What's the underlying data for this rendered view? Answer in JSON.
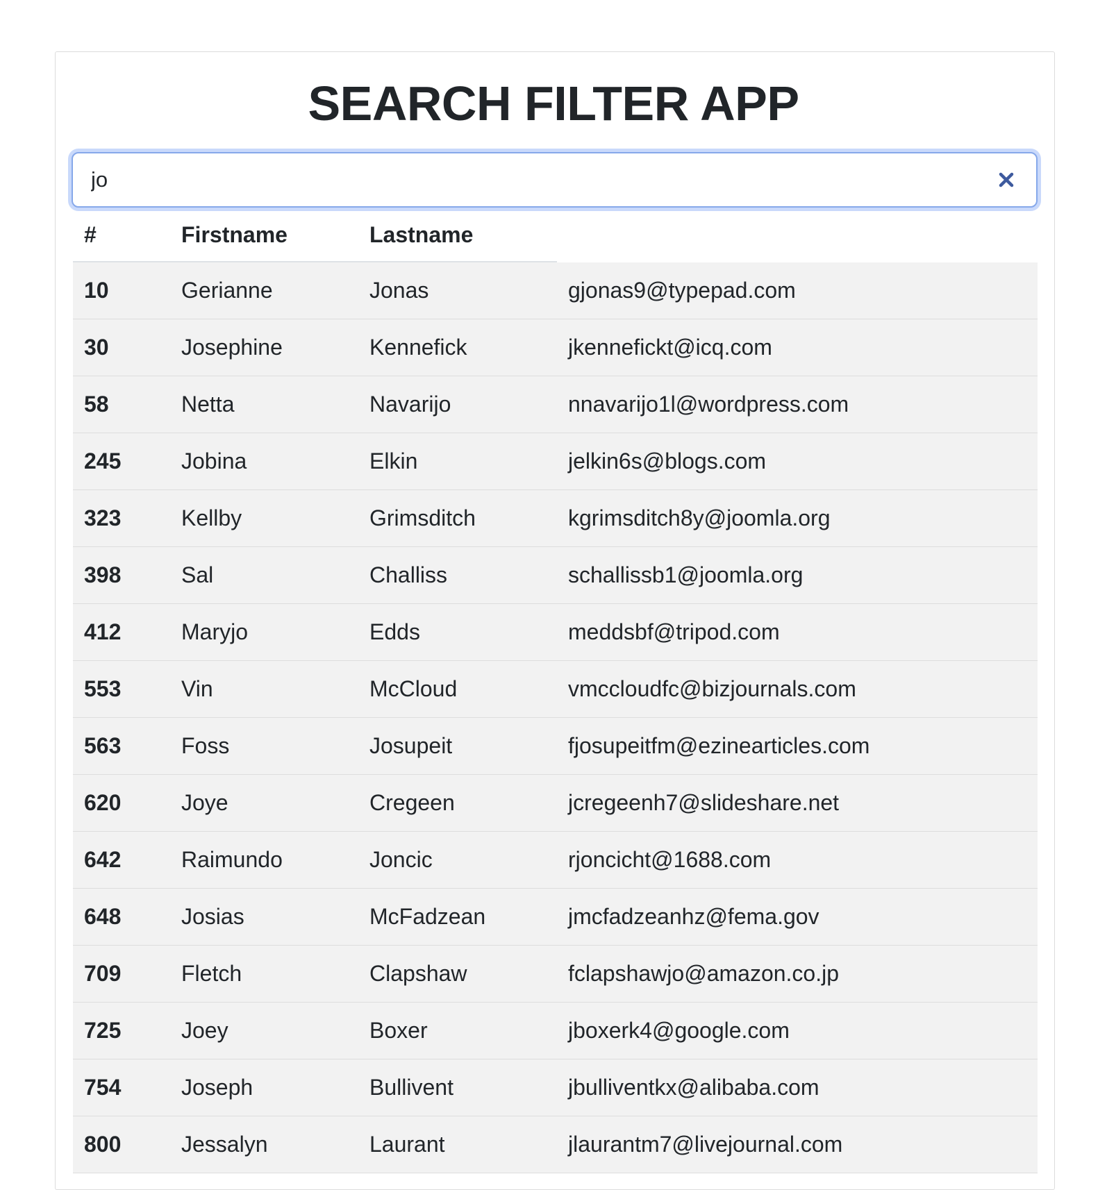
{
  "app": {
    "title": "SEARCH FILTER APP"
  },
  "search": {
    "value": "jo",
    "placeholder": "",
    "clear_icon": "close-icon"
  },
  "table": {
    "headers": [
      "#",
      "Firstname",
      "Lastname"
    ],
    "rows": [
      {
        "id": "10",
        "firstname": "Gerianne",
        "lastname": "Jonas",
        "email": "gjonas9@typepad.com"
      },
      {
        "id": "30",
        "firstname": "Josephine",
        "lastname": "Kennefick",
        "email": "jkennefickt@icq.com"
      },
      {
        "id": "58",
        "firstname": "Netta",
        "lastname": "Navarijo",
        "email": "nnavarijo1l@wordpress.com"
      },
      {
        "id": "245",
        "firstname": "Jobina",
        "lastname": "Elkin",
        "email": "jelkin6s@blogs.com"
      },
      {
        "id": "323",
        "firstname": "Kellby",
        "lastname": "Grimsditch",
        "email": "kgrimsditch8y@joomla.org"
      },
      {
        "id": "398",
        "firstname": "Sal",
        "lastname": "Challiss",
        "email": "schallissb1@joomla.org"
      },
      {
        "id": "412",
        "firstname": "Maryjo",
        "lastname": "Edds",
        "email": "meddsbf@tripod.com"
      },
      {
        "id": "553",
        "firstname": "Vin",
        "lastname": "McCloud",
        "email": "vmccloudfc@bizjournals.com"
      },
      {
        "id": "563",
        "firstname": "Foss",
        "lastname": "Josupeit",
        "email": "fjosupeitfm@ezinearticles.com"
      },
      {
        "id": "620",
        "firstname": "Joye",
        "lastname": "Cregeen",
        "email": "jcregeenh7@slideshare.net"
      },
      {
        "id": "642",
        "firstname": "Raimundo",
        "lastname": "Joncic",
        "email": "rjoncicht@1688.com"
      },
      {
        "id": "648",
        "firstname": "Josias",
        "lastname": "McFadzean",
        "email": "jmcfadzeanhz@fema.gov"
      },
      {
        "id": "709",
        "firstname": "Fletch",
        "lastname": "Clapshaw",
        "email": "fclapshawjo@amazon.co.jp"
      },
      {
        "id": "725",
        "firstname": "Joey",
        "lastname": "Boxer",
        "email": "jboxerk4@google.com"
      },
      {
        "id": "754",
        "firstname": "Joseph",
        "lastname": "Bullivent",
        "email": "jbulliventkx@alibaba.com"
      },
      {
        "id": "800",
        "firstname": "Jessalyn",
        "lastname": "Laurant",
        "email": "jlaurantm7@livejournal.com"
      }
    ]
  },
  "colors": {
    "row_background": "#f2f2f2",
    "focus_border": "#86a8ea",
    "focus_ring": "#c9d9fb",
    "clear_icon": "#3d5a9e",
    "text": "#212529"
  }
}
